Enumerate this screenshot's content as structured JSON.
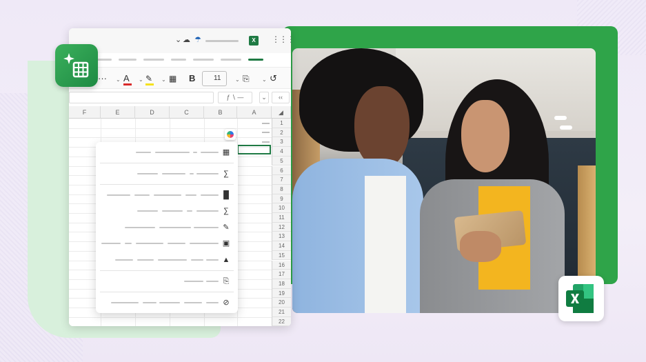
{
  "ribbon": {
    "more": "···",
    "font_color": "A",
    "bold": "B",
    "font_size": "11"
  },
  "columns": [
    "A",
    "B",
    "C",
    "D",
    "E",
    "F"
  ],
  "rows": [
    "1",
    "2",
    "3",
    "4",
    "5",
    "6",
    "7",
    "8",
    "9",
    "10",
    "11",
    "12",
    "13",
    "14",
    "15",
    "16",
    "17",
    "18",
    "19",
    "20",
    "21",
    "22"
  ],
  "colors": {
    "excel_green": "#1f7a44",
    "accent_green": "#2fa449"
  },
  "icons": [
    "sparkle-table-icon",
    "excel-icon",
    "copilot-icon",
    "table-icon",
    "chart-icon",
    "format-icon",
    "erase-icon"
  ]
}
